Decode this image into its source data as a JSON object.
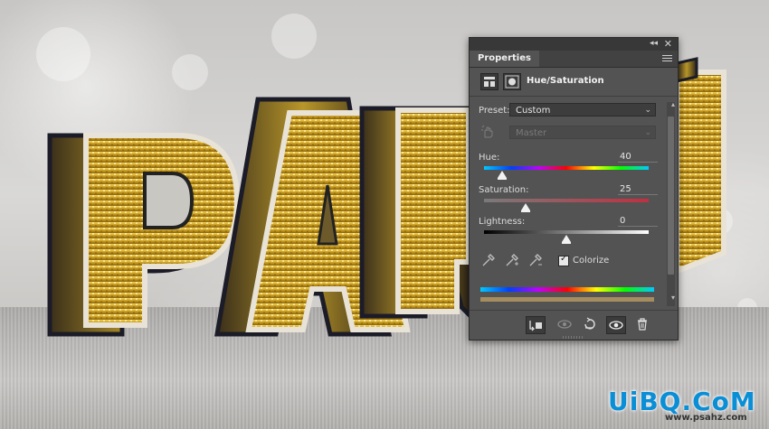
{
  "panel": {
    "tab_label": "Properties",
    "collapse_icon": "double-chevron-icon",
    "close_icon": "close-icon",
    "menu_icon": "panel-menu-icon",
    "adjustment_title": "Hue/Saturation",
    "preset_label": "Preset:",
    "preset_value": "Custom",
    "channel_value": "Master",
    "hue": {
      "label": "Hue:",
      "value": "40",
      "slider_fraction": 0.11
    },
    "saturation": {
      "label": "Saturation:",
      "value": "25",
      "slider_fraction": 0.25
    },
    "lightness": {
      "label": "Lightness:",
      "value": "0",
      "slider_fraction": 0.5
    },
    "colorize_label": "Colorize",
    "colorize_checked": true,
    "tint_color": "#a58d60"
  },
  "watermark": {
    "text": "UiBQ.CoM",
    "url": "www.psahz.com"
  }
}
